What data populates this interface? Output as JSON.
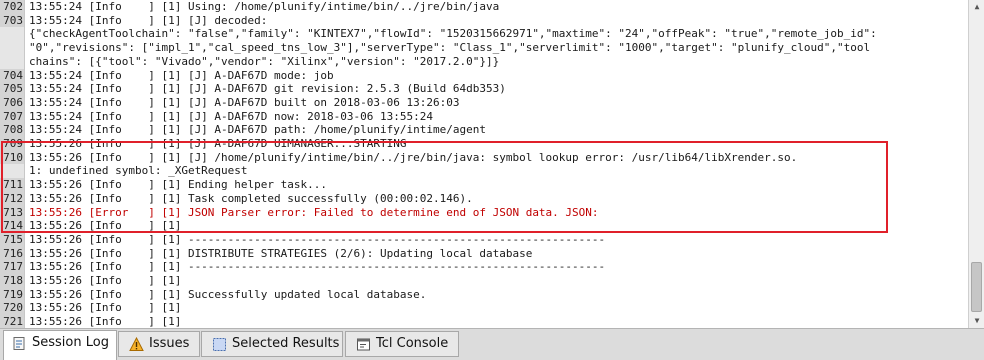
{
  "log": {
    "lines": [
      {
        "ln": "702",
        "text": "13:55:24 [Info    ] [1] Using: /home/plunify/intime/bin/../jre/bin/java"
      },
      {
        "ln": "703",
        "text": "13:55:24 [Info    ] [1] [J] decoded:"
      },
      {
        "ln": "",
        "text": "{\"checkAgentToolchain\": \"false\",\"family\": \"KINTEX7\",\"flowId\": \"1520315662971\",\"maxtime\": \"24\",\"offPeak\": \"true\",\"remote_job_id\":"
      },
      {
        "ln": "",
        "text": "\"0\",\"revisions\": [\"impl_1\",\"cal_speed_tns_low_3\"],\"serverType\": \"Class_1\",\"serverlimit\": \"1000\",\"target\": \"plunify_cloud\",\"tool"
      },
      {
        "ln": "",
        "text": "chains\": [{\"tool\": \"Vivado\",\"vendor\": \"Xilinx\",\"version\": \"2017.2.0\"}]}"
      },
      {
        "ln": "704",
        "text": "13:55:24 [Info    ] [1] [J] A-DAF67D mode: job"
      },
      {
        "ln": "705",
        "text": "13:55:24 [Info    ] [1] [J] A-DAF67D git revision: 2.5.3 (Build 64db353)"
      },
      {
        "ln": "706",
        "text": "13:55:24 [Info    ] [1] [J] A-DAF67D built on 2018-03-06 13:26:03"
      },
      {
        "ln": "707",
        "text": "13:55:24 [Info    ] [1] [J] A-DAF67D now: 2018-03-06 13:55:24"
      },
      {
        "ln": "708",
        "text": "13:55:24 [Info    ] [1] [J] A-DAF67D path: /home/plunify/intime/agent"
      },
      {
        "ln": "709",
        "text": "13:55:26 [Info    ] [1] [J] A-DAF67D UIMANAGER...STARTING"
      },
      {
        "ln": "710",
        "text": "13:55:26 [Info    ] [1] [J] /home/plunify/intime/bin/../jre/bin/java: symbol lookup error: /usr/lib64/libXrender.so."
      },
      {
        "ln": "",
        "text": "1: undefined symbol: _XGetRequest"
      },
      {
        "ln": "711",
        "text": "13:55:26 [Info    ] [1] Ending helper task..."
      },
      {
        "ln": "712",
        "text": "13:55:26 [Info    ] [1] Task completed successfully (00:00:02.146)."
      },
      {
        "ln": "713",
        "text": "13:55:26 [Error   ] [1] JSON Parser error: Failed to determine end of JSON data. JSON:",
        "error": true
      },
      {
        "ln": "714",
        "text": "13:55:26 [Info    ] [1]"
      },
      {
        "ln": "715",
        "text": "13:55:26 [Info    ] [1] ---------------------------------------------------------------"
      },
      {
        "ln": "716",
        "text": "13:55:26 [Info    ] [1] DISTRIBUTE STRATEGIES (2/6): Updating local database"
      },
      {
        "ln": "717",
        "text": "13:55:26 [Info    ] [1] ---------------------------------------------------------------"
      },
      {
        "ln": "718",
        "text": "13:55:26 [Info    ] [1]"
      },
      {
        "ln": "719",
        "text": "13:55:26 [Info    ] [1] Successfully updated local database."
      },
      {
        "ln": "720",
        "text": "13:55:26 [Info    ] [1]"
      },
      {
        "ln": "721",
        "text": "13:55:26 [Info    ] [1]"
      }
    ]
  },
  "tabs": [
    {
      "label": "Session Log",
      "icon": "session-log-icon",
      "active": true
    },
    {
      "label": "Issues",
      "icon": "warning-icon",
      "active": false
    },
    {
      "label": "Selected Results",
      "icon": "selected-results-icon",
      "active": false
    },
    {
      "label": "Tcl Console",
      "icon": "tcl-console-icon",
      "active": false
    }
  ],
  "colors": {
    "error_text": "#c00000",
    "highlight_border": "#e0202a",
    "warning_icon": "#f0a000"
  }
}
